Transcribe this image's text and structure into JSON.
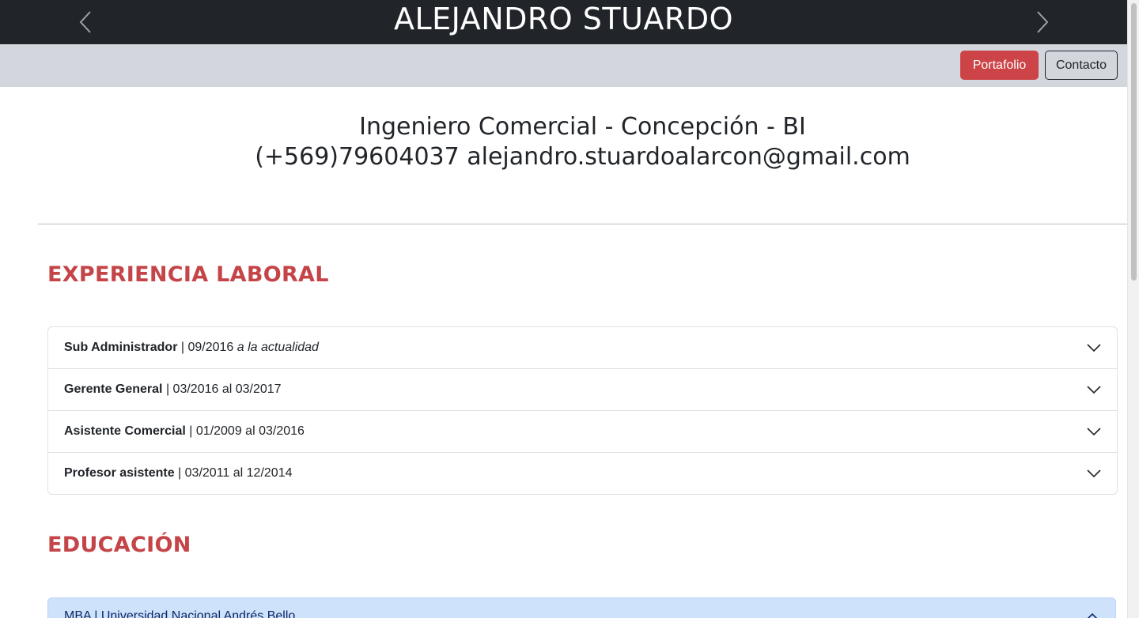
{
  "header": {
    "title": "ALEJANDRO STUARDO",
    "prev_icon": "chevron-left-icon",
    "next_icon": "chevron-right-icon"
  },
  "nav": {
    "portfolio_label": "Portafolio",
    "contact_label": "Contacto",
    "accent_color": "#cc4447"
  },
  "profile": {
    "line1": "Ingeniero Comercial - Concepción - BI",
    "line2": "(+569)79604037 alejandro.stuardoalarcon@gmail.com"
  },
  "experience": {
    "title": "EXPERIENCIA LABORAL",
    "items": [
      {
        "role": "Sub Administrador",
        "dates": " | 09/2016 ",
        "note": "a la actualidad"
      },
      {
        "role": "Gerente General",
        "dates": " | 03/2016 al 03/2017",
        "note": ""
      },
      {
        "role": "Asistente Comercial",
        "dates": " | 01/2009 al 03/2016",
        "note": ""
      },
      {
        "role": "Profesor asistente",
        "dates": " | 03/2011 al 12/2014",
        "note": ""
      }
    ]
  },
  "education": {
    "title": "EDUCACIÓN",
    "items": [
      {
        "label": "MBA | Universidad Nacional Andrés Bello",
        "expanded": true
      }
    ]
  }
}
